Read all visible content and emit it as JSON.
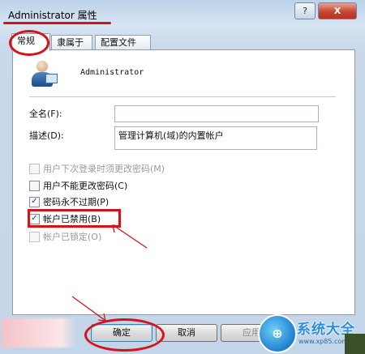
{
  "window": {
    "title": "Administrator 属性",
    "help_button": "?",
    "close_button": "X"
  },
  "tabs": [
    {
      "label": "常规",
      "active": true
    },
    {
      "label": "隶属于",
      "active": false
    },
    {
      "label": "配置文件",
      "active": false
    }
  ],
  "user": {
    "name": "Administrator",
    "icon": "user-computer-icon"
  },
  "fields": {
    "fullname_label": "全名(F):",
    "fullname_value": "",
    "description_label": "描述(D):",
    "description_value": "管理计算机(域)的内置帐户"
  },
  "checkboxes": [
    {
      "label": "用户下次登录时须更改密码(M)",
      "checked": false,
      "enabled": false
    },
    {
      "label": "用户不能更改密码(C)",
      "checked": false,
      "enabled": true
    },
    {
      "label": "密码永不过期(P)",
      "checked": true,
      "enabled": true
    },
    {
      "label": "帐户已禁用(B)",
      "checked": true,
      "enabled": true
    },
    {
      "label": "帐户已锁定(O)",
      "checked": false,
      "enabled": false
    }
  ],
  "buttons": {
    "ok": "确定",
    "cancel": "取消",
    "apply": "应用"
  },
  "watermark": {
    "text": "系统大全",
    "url": "www.xp85.com"
  },
  "colors": {
    "annotation_red": "#d4141a",
    "accent_blue": "#2b8ed8"
  }
}
